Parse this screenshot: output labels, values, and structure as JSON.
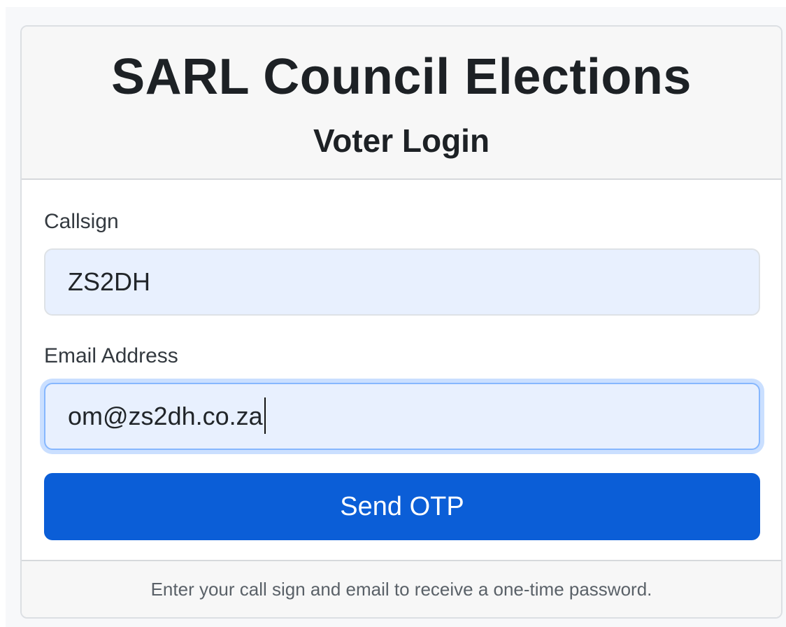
{
  "header": {
    "title": "SARL Council Elections",
    "subtitle": "Voter Login"
  },
  "form": {
    "callsign": {
      "label": "Callsign",
      "value": "ZS2DH"
    },
    "email": {
      "label": "Email Address",
      "value": "om@zs2dh.co.za",
      "focused": true
    },
    "submit_label": "Send OTP"
  },
  "footer": {
    "text": "Enter your call sign and email to receive a one-time password."
  },
  "colors": {
    "primary": "#0b5ed7",
    "input_background": "#e8f0fe",
    "focus_ring": "#86b7fe",
    "header_background": "#f7f7f7"
  }
}
